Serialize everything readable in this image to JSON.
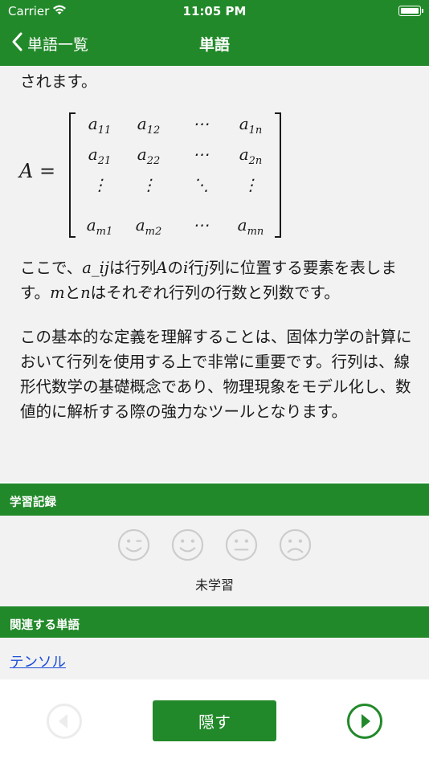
{
  "status_bar": {
    "carrier": "Carrier",
    "time": "11:05 PM"
  },
  "nav": {
    "back_label": "単語一覧",
    "title": "単語"
  },
  "content": {
    "top_text": "されます。",
    "matrix": {
      "lhs": "A =",
      "rows": [
        [
          {
            "b": "a",
            "s": "11"
          },
          {
            "b": "a",
            "s": "12"
          },
          {
            "b": "⋯",
            "s": ""
          },
          {
            "b": "a",
            "s": "1n"
          }
        ],
        [
          {
            "b": "a",
            "s": "21"
          },
          {
            "b": "a",
            "s": "22"
          },
          {
            "b": "⋯",
            "s": ""
          },
          {
            "b": "a",
            "s": "2n"
          }
        ],
        [
          {
            "b": "⋮",
            "s": ""
          },
          {
            "b": "⋮",
            "s": ""
          },
          {
            "b": "⋱",
            "s": ""
          },
          {
            "b": "⋮",
            "s": ""
          }
        ],
        [
          {
            "b": "a",
            "s": "m1"
          },
          {
            "b": "a",
            "s": "m2"
          },
          {
            "b": "⋯",
            "s": ""
          },
          {
            "b": "a",
            "s": "mn"
          }
        ]
      ]
    },
    "explain": {
      "p1": "ここで、",
      "aij": "a_ij",
      "p2": "は行列",
      "A": "A",
      "p3": "の",
      "i": "i",
      "p4": "行",
      "j": "j",
      "p5": "列に位置する要素を表します。",
      "m": "m",
      "p6": "と",
      "n": "n",
      "p7": "はそれぞれ行列の行数と列数です。"
    },
    "paragraph": "この基本的な定義を理解することは、固体力学の計算において行列を使用する上で非常に重要です。行列は、線形代数学の基礎概念であり、物理現象をモデル化し、数値的に解析する際の強力なツールとなります。"
  },
  "learning_record": {
    "header": "学習記録",
    "faces": [
      "wink-face",
      "smile-face",
      "neutral-face",
      "sad-face"
    ],
    "status": "未学習"
  },
  "related": {
    "header": "関連する単語",
    "items": [
      "テンソル"
    ]
  },
  "bottom": {
    "hide_label": "隠す"
  },
  "colors": {
    "accent": "#22892a",
    "link": "#1a4dd8",
    "face_gray": "#cccccc"
  }
}
